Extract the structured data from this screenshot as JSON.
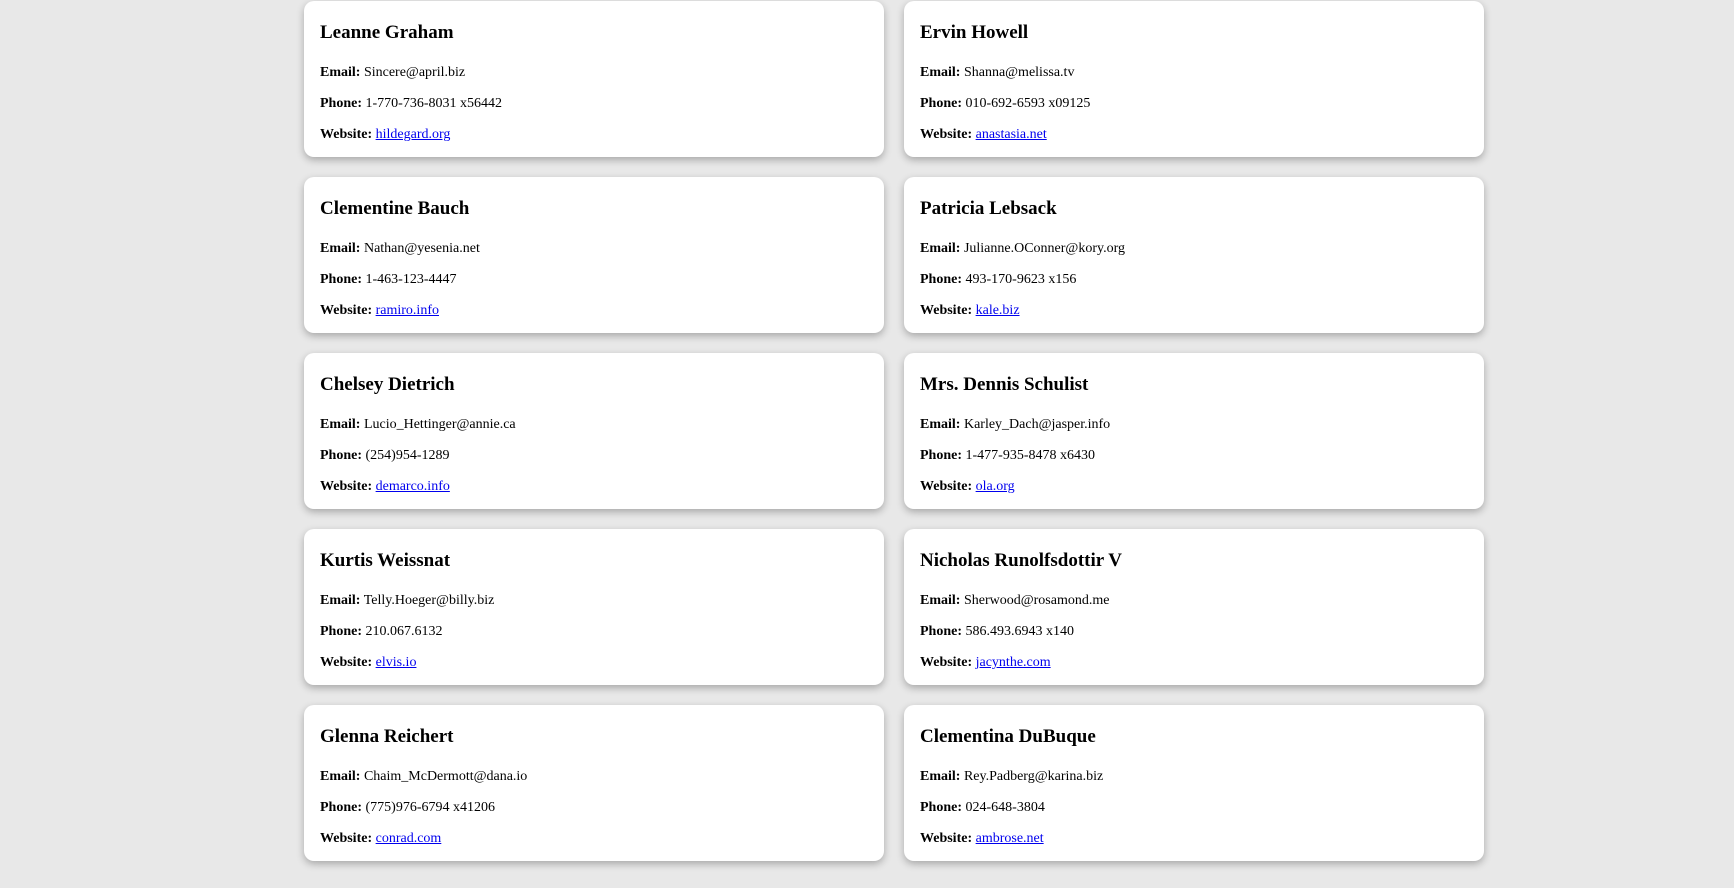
{
  "labels": {
    "email": "Email:",
    "phone": "Phone:",
    "website": "Website:"
  },
  "colors": {
    "background": "#e8e8e8",
    "card": "#ffffff",
    "link": "#0000ee"
  },
  "users": [
    {
      "name": "Leanne Graham",
      "email": "Sincere@april.biz",
      "phone": "1-770-736-8031 x56442",
      "website": "hildegard.org"
    },
    {
      "name": "Ervin Howell",
      "email": "Shanna@melissa.tv",
      "phone": "010-692-6593 x09125",
      "website": "anastasia.net"
    },
    {
      "name": "Clementine Bauch",
      "email": "Nathan@yesenia.net",
      "phone": "1-463-123-4447",
      "website": "ramiro.info"
    },
    {
      "name": "Patricia Lebsack",
      "email": "Julianne.OConner@kory.org",
      "phone": "493-170-9623 x156",
      "website": "kale.biz"
    },
    {
      "name": "Chelsey Dietrich",
      "email": "Lucio_Hettinger@annie.ca",
      "phone": "(254)954-1289",
      "website": "demarco.info"
    },
    {
      "name": "Mrs. Dennis Schulist",
      "email": "Karley_Dach@jasper.info",
      "phone": "1-477-935-8478 x6430",
      "website": "ola.org"
    },
    {
      "name": "Kurtis Weissnat",
      "email": "Telly.Hoeger@billy.biz",
      "phone": "210.067.6132",
      "website": "elvis.io"
    },
    {
      "name": "Nicholas Runolfsdottir V",
      "email": "Sherwood@rosamond.me",
      "phone": "586.493.6943 x140",
      "website": "jacynthe.com"
    },
    {
      "name": "Glenna Reichert",
      "email": "Chaim_McDermott@dana.io",
      "phone": "(775)976-6794 x41206",
      "website": "conrad.com"
    },
    {
      "name": "Clementina DuBuque",
      "email": "Rey.Padberg@karina.biz",
      "phone": "024-648-3804",
      "website": "ambrose.net"
    }
  ]
}
